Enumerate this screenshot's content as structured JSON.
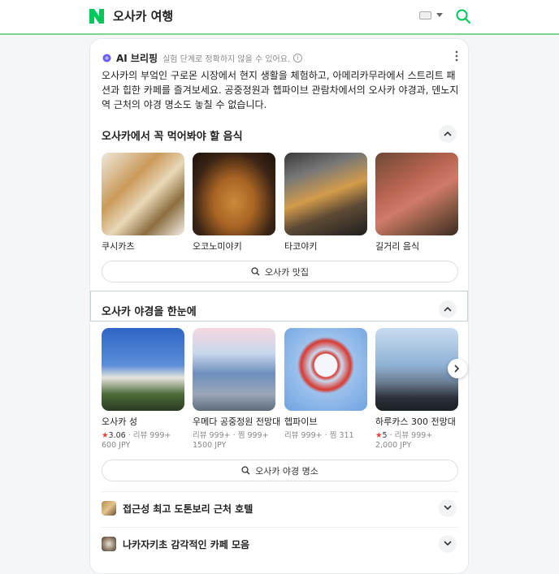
{
  "header": {
    "query": "오사카 여행",
    "icons": {
      "logo": "naver-logo-icon",
      "keyboard": "keyboard-icon",
      "search": "search-icon"
    },
    "colors": {
      "brand": "#03c75a"
    }
  },
  "ai": {
    "title": "AI 브리핑",
    "note": "실험 단계로 정확하지 않을 수 있어요.",
    "summary": "오사카의 부엌인 구로몬 시장에서 현지 생활을 체험하고, 아메리카무라에서 스트리트 패션과 힙한 카페를 즐겨보세요. 공중정원과 헵파이브 관람차에서의 오사카 야경과, 덴노지역 근처의 야경 명소도 놓칠 수 없습니다."
  },
  "food": {
    "title": "오사카에서 꼭 먹어봐야 할 음식",
    "items": [
      {
        "label": "쿠시카츠"
      },
      {
        "label": "오코노미야키"
      },
      {
        "label": "타코야키"
      },
      {
        "label": "길거리 음식"
      }
    ],
    "button": "오사카 맛집"
  },
  "night": {
    "title": "오사카 야경을 한눈에",
    "items": [
      {
        "label": "오사카 성",
        "rating": "3.06",
        "reviews": "리뷰 999+",
        "price": "600 JPY"
      },
      {
        "label": "우메다 공중정원 전망대",
        "reviews": "리뷰 999+",
        "saves": "찜 999+",
        "price": "1500 JPY"
      },
      {
        "label": "헵파이브",
        "reviews": "리뷰 999+",
        "saves": "찜 311"
      },
      {
        "label": "하루카스 300 전망대",
        "rating": "5",
        "reviews": "리뷰 999+",
        "price": "2,000 JPY"
      }
    ],
    "button": "오사카 야경 명소"
  },
  "more": [
    {
      "label": "접근성 최고 도톤보리 근처 호텔"
    },
    {
      "label": "나카자키초 감각적인 카페 모음"
    }
  ],
  "symbols": {
    "star": "★",
    "dot": "·"
  }
}
